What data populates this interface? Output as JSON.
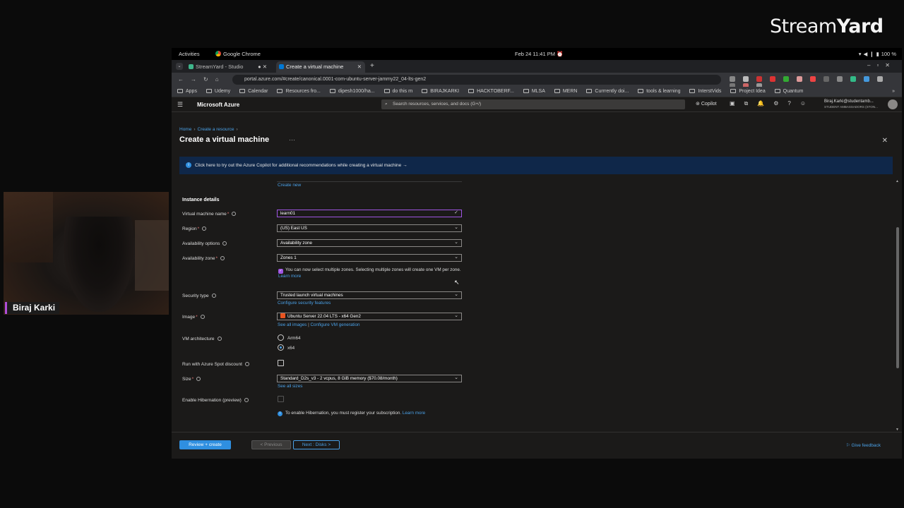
{
  "streamyard": {
    "logo_light": "Stream",
    "logo_bold": "Yard",
    "participant_name": "Biraj Karki"
  },
  "os_bar": {
    "activities": "Activities",
    "app_name": "Google Chrome",
    "datetime": "Feb 24  11:41 PM",
    "battery": "100 %"
  },
  "browser": {
    "tabs": [
      {
        "label": "StreamYard - Studio",
        "active": false
      },
      {
        "label": "Create a virtual machine",
        "active": true
      }
    ],
    "url": "portal.azure.com/#create/canonical.0001-com-ubuntu-server-jammy22_04-lts-gen2",
    "bookmarks": [
      "Apps",
      "Udemy",
      "Calendar",
      "Resources fro...",
      "dipesh1000/ha...",
      "do this rn",
      "BIRAJKARKI",
      "HACKTOBERF...",
      "MLSA",
      "MERN",
      "Currrently doi...",
      "tools & learning",
      "InterstVids",
      "Project Idea",
      "Quantum"
    ],
    "bookmarks_overflow": "»"
  },
  "azure_header": {
    "brand": "Microsoft Azure",
    "search_placeholder": "Search resources, services, and docs (G+/)",
    "copilot": "Copilot",
    "user_email": "Biraj.Karki@studentamb...",
    "user_org": "STUDENT AMBASSADORS (STON..."
  },
  "blade": {
    "breadcrumb": [
      "Home",
      "Create a resource"
    ],
    "title": "Create a virtual machine",
    "title_more": "···",
    "banner_text": "Click here to try out the Azure Copilot for additional recommendations while creating a virtual machine  →"
  },
  "form": {
    "create_new_link": "Create new",
    "section_heading": "Instance details",
    "vm_name": {
      "label": "Virtual machine name",
      "value": "learn01"
    },
    "region": {
      "label": "Region",
      "value": "(US) East US"
    },
    "availability_options": {
      "label": "Availability options",
      "value": "Availability zone"
    },
    "availability_zone": {
      "label": "Availability zone",
      "value": "Zones 1",
      "note": "You can now select multiple zones. Selecting multiple zones will create one VM per zone.",
      "note_link": "Learn more"
    },
    "security_type": {
      "label": "Security type",
      "value": "Trusted launch virtual machines",
      "link": "Configure security features"
    },
    "image": {
      "label": "Image",
      "value": "Ubuntu Server 22.04 LTS - x64 Gen2",
      "link1": "See all images",
      "link_sep": "|",
      "link2": "Configure VM generation"
    },
    "vm_architecture": {
      "label": "VM architecture",
      "options": [
        "Arm64",
        "x64"
      ],
      "selected": "x64"
    },
    "spot": {
      "label": "Run with Azure Spot discount",
      "checked": false
    },
    "size": {
      "label": "Size",
      "value": "Standard_D2s_v3 - 2 vcpus, 8 GiB memory ($70.08/month)",
      "link": "See all sizes"
    },
    "hibernation": {
      "label": "Enable Hibernation (preview)",
      "checked": false,
      "note": "To enable Hibernation, you must register your subscription.",
      "note_link": "Learn more"
    }
  },
  "footer": {
    "review_create": "Review + create",
    "previous": "< Previous",
    "next": "Next : Disks >",
    "feedback": "Give feedback"
  },
  "colors": {
    "azure_blue": "#2f8fe0",
    "link_blue": "#4aa0e6",
    "focus_purple": "#9f55e3",
    "banner_bg": "#0f2749",
    "streamyard_accent": "#b04dd9"
  }
}
